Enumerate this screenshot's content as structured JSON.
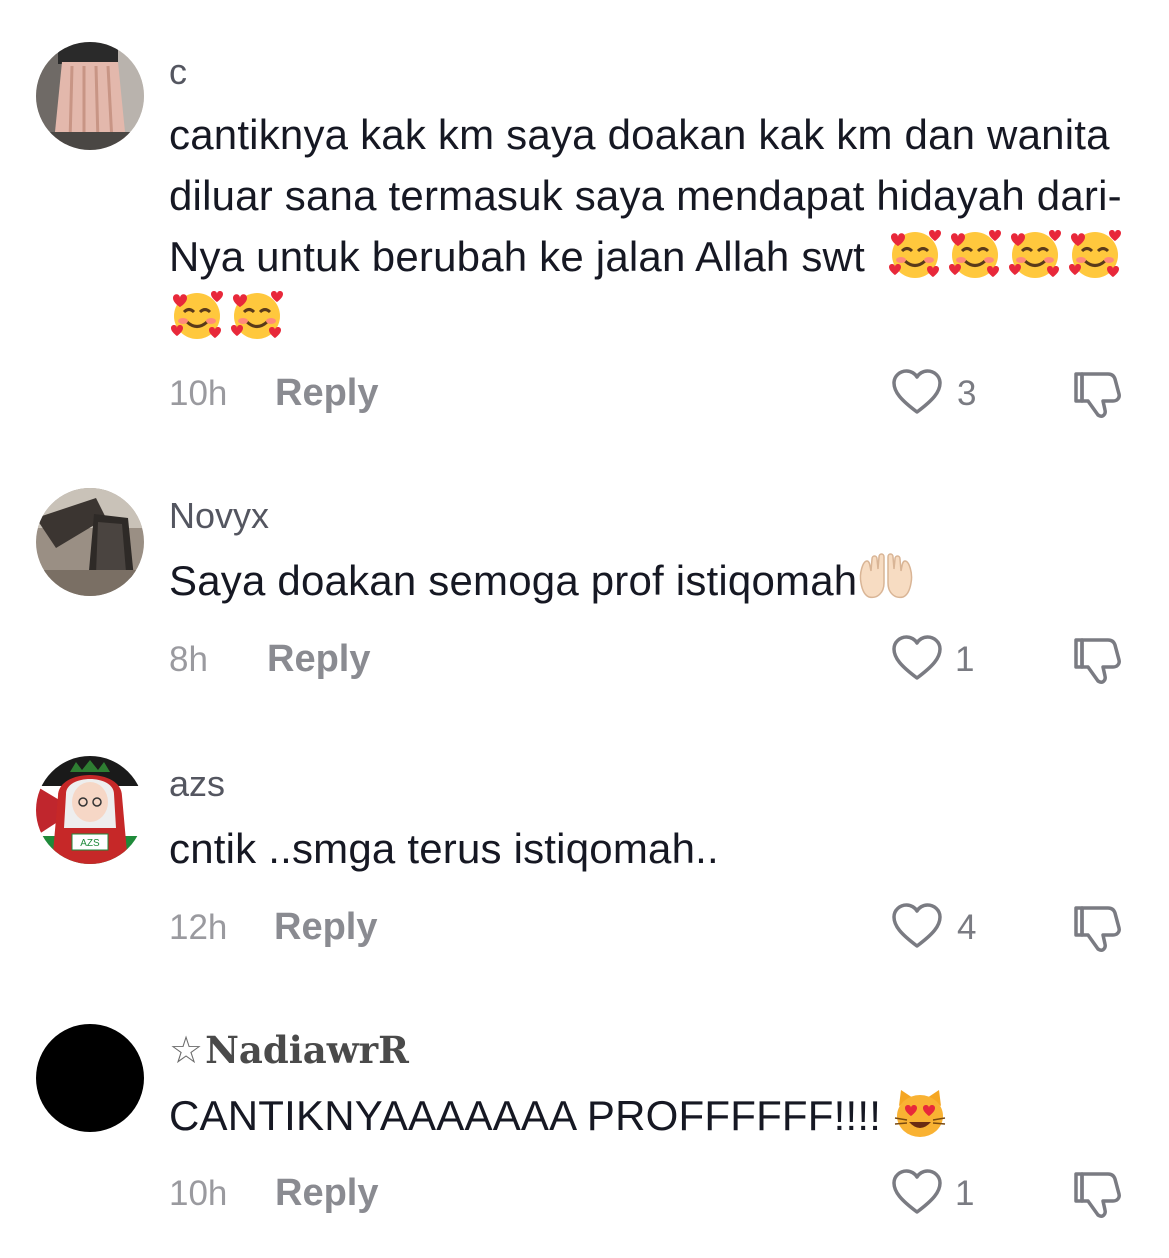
{
  "comments": [
    {
      "username": "c",
      "text": "cantiknya kak km saya doakan kak km dan wanita diluar sana termasuk saya mendapat hidayah dari-Nya untuk berubah ke jalan Allah swt",
      "emoji": "smiling-face-with-hearts",
      "emoji_count": 6,
      "time": "10h",
      "reply_label": "Reply",
      "likes": "3"
    },
    {
      "username": "Novyx",
      "text": "Saya doakan semoga prof istiqomah",
      "emoji": "palms-up-together",
      "time": "8h",
      "reply_label": "Reply",
      "likes": "1"
    },
    {
      "username": "azs",
      "avatar_label": "AZS",
      "text": "cntik ..smga terus istiqomah..",
      "time": "12h",
      "reply_label": "Reply",
      "likes": "4"
    },
    {
      "username": "NadiawrR",
      "username_prefix_icon": "star-outline-icon",
      "text": "CANTIKNYAAAAAAA PROFFFFFF!!!!",
      "emoji": "smiling-cat-with-heart-eyes",
      "time": "10h",
      "reply_label": "Reply",
      "likes": "1"
    }
  ],
  "colors": {
    "text": "#161823",
    "username": "#545660",
    "secondary": "#8a8b91",
    "background": "#ffffff"
  }
}
